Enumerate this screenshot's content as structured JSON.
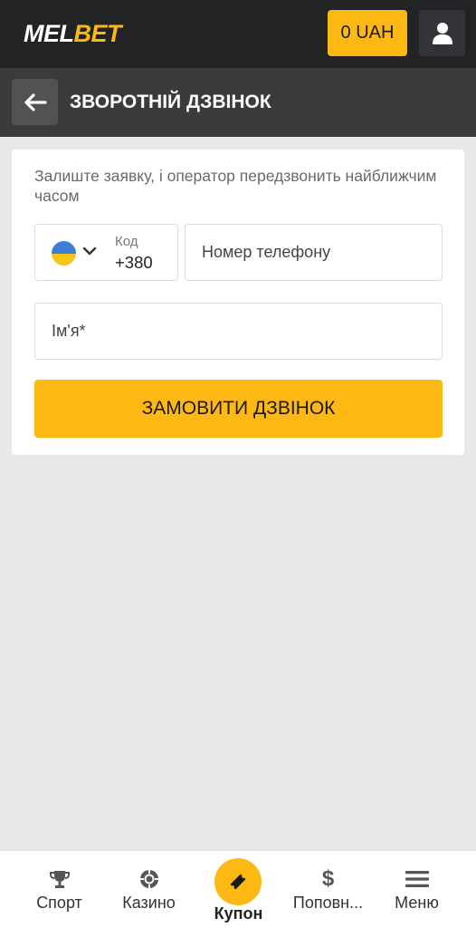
{
  "header": {
    "logo_part1": "MEL",
    "logo_part2": "BET",
    "balance": "0 UAH",
    "accent_color": "#fdb813"
  },
  "subheader": {
    "title": "ЗВОРОТНІЙ ДЗВІНОК"
  },
  "form": {
    "intro": "Залиште заявку, і оператор передзвонить найближчим часом",
    "code_label": "Код",
    "code_value": "+380",
    "country_flag": "ukraine-flag-icon",
    "phone_placeholder": "Номер телефону",
    "name_placeholder": "Ім'я*",
    "submit_label": "ЗАМОВИТИ ДЗВІНОК"
  },
  "bottom_nav": {
    "items": [
      {
        "label": "Спорт",
        "icon": "trophy-icon"
      },
      {
        "label": "Казино",
        "icon": "casino-chip-icon"
      },
      {
        "label": "Купон",
        "icon": "ticket-icon"
      },
      {
        "label": "Поповн...",
        "icon": "dollar-icon"
      },
      {
        "label": "Меню",
        "icon": "menu-icon"
      }
    ]
  }
}
